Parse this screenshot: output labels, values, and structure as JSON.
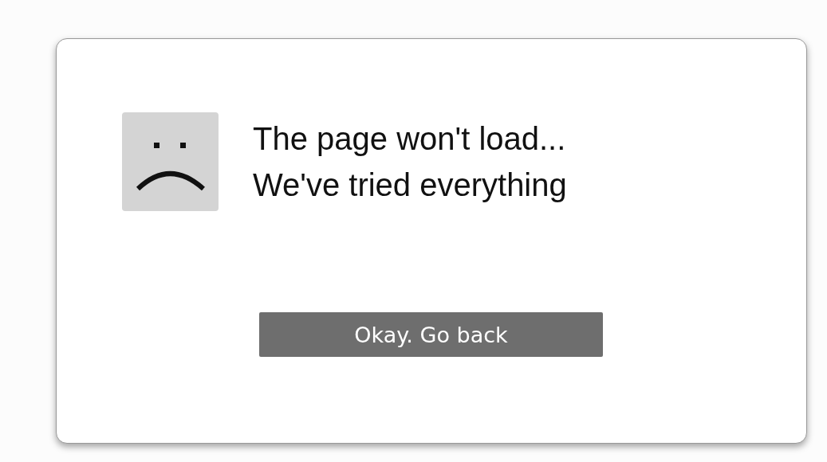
{
  "dialog": {
    "message_lines": [
      "The page won't load...",
      "We've tried everything"
    ],
    "button": {
      "label": "Okay. Go back"
    }
  }
}
